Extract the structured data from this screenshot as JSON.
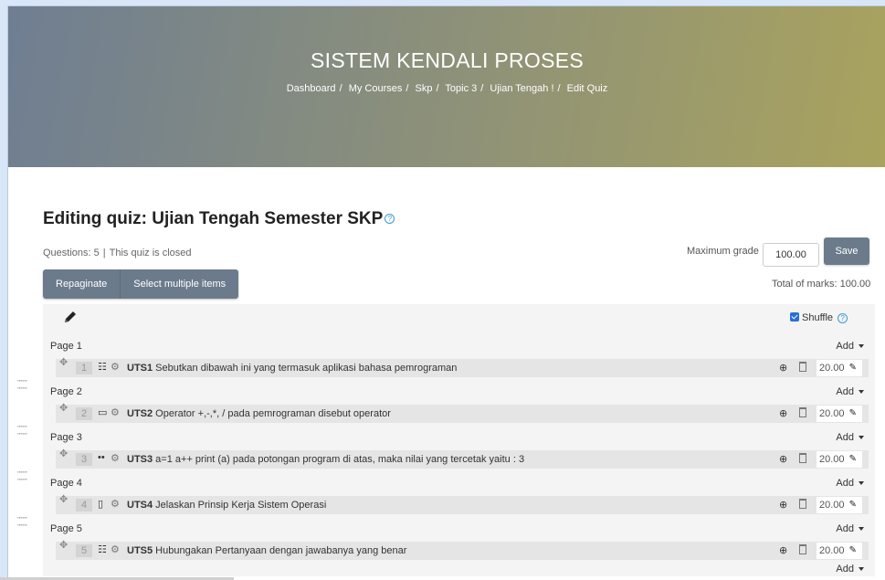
{
  "hero": {
    "title": "SISTEM KENDALI PROSES",
    "breadcrumb": [
      "Dashboard",
      "My Courses",
      "Skp",
      "Topic 3",
      "Ujian Tengah !",
      "Edit Quiz"
    ],
    "sep": "/"
  },
  "heading": {
    "title": "Editing quiz: Ujian Tengah Semester SKP",
    "help_icon": "?"
  },
  "info": {
    "questions": "Questions: 5",
    "sep": "|",
    "status": "This quiz is closed"
  },
  "grade": {
    "label": "Maximum grade",
    "value": "100.00",
    "save": "Save"
  },
  "toolbar": {
    "repaginate": "Repaginate",
    "select_multiple": "Select multiple items"
  },
  "total": "Total of marks: 100.00",
  "shuffle": {
    "label": "Shuffle",
    "checked": true,
    "help_icon": "?"
  },
  "add_label": "Add",
  "pages": [
    {
      "label": "Page 1",
      "slot": "1",
      "icon": "multichoice-icon",
      "glyph": "☷",
      "code": "UTS1",
      "text": " Sebutkan dibawah ini yang termasuk aplikasi bahasa pemrograman",
      "mark": "20.00"
    },
    {
      "label": "Page 2",
      "slot": "2",
      "icon": "shortanswer-icon",
      "glyph": "▭",
      "code": "UTS2",
      "text": " Operator +,-,*, /   pada pemrograman disebut operator",
      "mark": "20.00"
    },
    {
      "label": "Page 3",
      "slot": "3",
      "icon": "truefalse-icon",
      "glyph": "••",
      "code": "UTS3",
      "text": " a=1 a++ print (a) pada potongan program di atas, maka nilai yang tercetak yaitu : 3",
      "mark": "20.00"
    },
    {
      "label": "Page 4",
      "slot": "4",
      "icon": "essay-icon",
      "glyph": "▯",
      "code": "UTS4",
      "text": " Jelaskan Prinsip Kerja Sistem Operasi",
      "mark": "20.00"
    },
    {
      "label": "Page 5",
      "slot": "5",
      "icon": "matching-icon",
      "glyph": "☷",
      "code": "UTS5",
      "text": " Hubungakan Pertanyaan dengan jawabanya yang benar",
      "mark": "20.00"
    }
  ]
}
